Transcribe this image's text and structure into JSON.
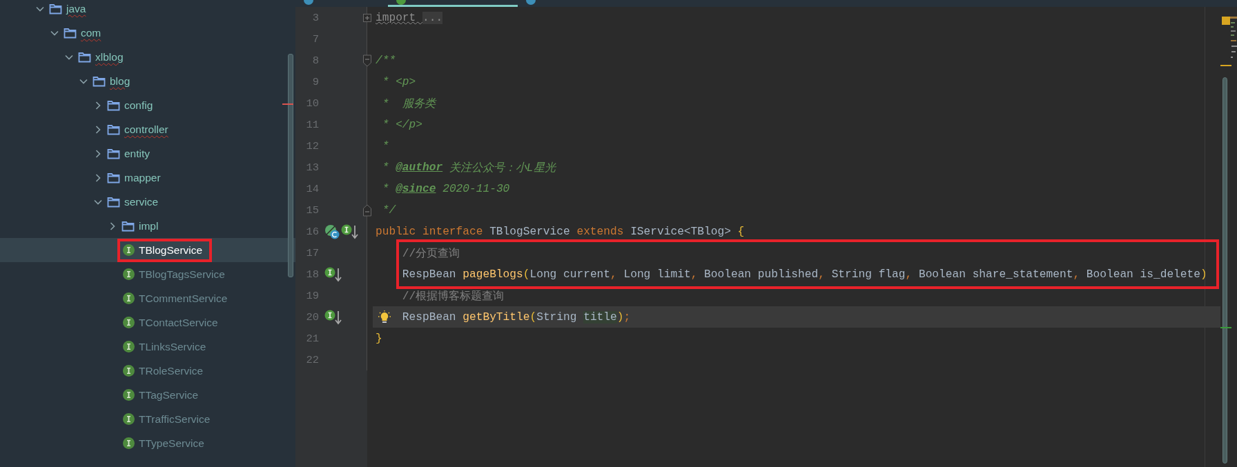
{
  "tabs": [
    {
      "color": "#3d8fb8",
      "selected": false
    },
    {
      "color": "#4e9a3e",
      "selected": true
    },
    {
      "color": "#3d8fb8",
      "selected": false
    }
  ],
  "project_tree": [
    {
      "label": "java",
      "kind": "folder",
      "expanded": true,
      "misspelled": true,
      "selected": false,
      "boxed": false,
      "children": [
        {
          "label": "com",
          "kind": "folder",
          "expanded": true,
          "misspelled": true,
          "selected": false,
          "boxed": false,
          "children": [
            {
              "label": "xlblog",
              "kind": "folder",
              "expanded": true,
              "misspelled": true,
              "selected": false,
              "boxed": false,
              "children": [
                {
                  "label": "blog",
                  "kind": "folder",
                  "expanded": true,
                  "misspelled": true,
                  "selected": false,
                  "boxed": false,
                  "children": [
                    {
                      "label": "config",
                      "kind": "folder",
                      "expanded": false,
                      "misspelled": false,
                      "selected": false,
                      "boxed": false
                    },
                    {
                      "label": "controller",
                      "kind": "folder",
                      "expanded": false,
                      "misspelled": true,
                      "selected": false,
                      "boxed": false
                    },
                    {
                      "label": "entity",
                      "kind": "folder",
                      "expanded": false,
                      "misspelled": false,
                      "selected": false,
                      "boxed": false
                    },
                    {
                      "label": "mapper",
                      "kind": "folder",
                      "expanded": false,
                      "misspelled": false,
                      "selected": false,
                      "boxed": false
                    },
                    {
                      "label": "service",
                      "kind": "folder",
                      "expanded": true,
                      "misspelled": false,
                      "selected": false,
                      "boxed": false,
                      "children": [
                        {
                          "label": "impl",
                          "kind": "folder",
                          "expanded": false,
                          "misspelled": false,
                          "selected": false,
                          "boxed": false
                        },
                        {
                          "label": "TBlogService",
                          "kind": "interface",
                          "misspelled": false,
                          "selected": true,
                          "boxed": true
                        },
                        {
                          "label": "TBlogTagsService",
                          "kind": "interface",
                          "misspelled": false,
                          "selected": false,
                          "boxed": false
                        },
                        {
                          "label": "TCommentService",
                          "kind": "interface",
                          "misspelled": false,
                          "selected": false,
                          "boxed": false
                        },
                        {
                          "label": "TContactService",
                          "kind": "interface",
                          "misspelled": false,
                          "selected": false,
                          "boxed": false
                        },
                        {
                          "label": "TLinksService",
                          "kind": "interface",
                          "misspelled": false,
                          "selected": false,
                          "boxed": false
                        },
                        {
                          "label": "TRoleService",
                          "kind": "interface",
                          "misspelled": false,
                          "selected": false,
                          "boxed": false
                        },
                        {
                          "label": "TTagService",
                          "kind": "interface",
                          "misspelled": false,
                          "selected": false,
                          "boxed": false
                        },
                        {
                          "label": "TTrafficService",
                          "kind": "interface",
                          "misspelled": false,
                          "selected": false,
                          "boxed": false
                        },
                        {
                          "label": "TTypeService",
                          "kind": "interface",
                          "misspelled": false,
                          "selected": false,
                          "boxed": false
                        }
                      ]
                    }
                  ]
                }
              ]
            }
          ]
        }
      ]
    }
  ],
  "editor": {
    "lines": [
      {
        "number": "3",
        "fold": {
          "kind": "collapsed"
        },
        "current": false,
        "boxed": false,
        "tokens": [
          {
            "kind": "unused",
            "text": "import "
          },
          {
            "kind": "folded",
            "text": "..."
          }
        ]
      },
      {
        "number": "7",
        "current": false,
        "boxed": false
      },
      {
        "number": "8",
        "fold": {
          "kind": "start"
        },
        "current": false,
        "boxed": false,
        "tokens": [
          {
            "kind": "doc",
            "text": "/**"
          }
        ]
      },
      {
        "number": "9",
        "current": false,
        "boxed": false,
        "tokens": [
          {
            "kind": "doc",
            "text": " * <p>"
          }
        ]
      },
      {
        "number": "10",
        "current": false,
        "boxed": false,
        "tokens": [
          {
            "kind": "doc",
            "text": " *  服务类"
          }
        ]
      },
      {
        "number": "11",
        "current": false,
        "boxed": false,
        "tokens": [
          {
            "kind": "doc",
            "text": " * </p>"
          }
        ]
      },
      {
        "number": "12",
        "current": false,
        "boxed": false,
        "tokens": [
          {
            "kind": "doc",
            "text": " *"
          }
        ]
      },
      {
        "number": "13",
        "current": false,
        "boxed": false,
        "tokens": [
          {
            "kind": "doc",
            "text": " * "
          },
          {
            "kind": "doctag",
            "text": "@author"
          },
          {
            "kind": "doc",
            "text": " 关注公众号：小L星光"
          }
        ]
      },
      {
        "number": "14",
        "current": false,
        "boxed": false,
        "tokens": [
          {
            "kind": "doc",
            "text": " * "
          },
          {
            "kind": "doctag",
            "text": "@since"
          },
          {
            "kind": "doc",
            "text": " 2020-11-30"
          }
        ]
      },
      {
        "number": "15",
        "fold": {
          "kind": "end"
        },
        "current": false,
        "boxed": false,
        "tokens": [
          {
            "kind": "doc",
            "text": " */"
          }
        ]
      },
      {
        "number": "16",
        "current": false,
        "boxed": false,
        "markers": [
          {
            "kind": "hierarchy"
          },
          {
            "kind": "implemented"
          }
        ],
        "tokens": [
          {
            "kind": "keyword",
            "text": "public interface "
          },
          {
            "kind": "plain",
            "text": "TBlogService "
          },
          {
            "kind": "keyword",
            "text": "extends "
          },
          {
            "kind": "plain",
            "text": "IService<TBlog> "
          },
          {
            "kind": "bracket",
            "text": "{"
          }
        ]
      },
      {
        "number": "17",
        "current": false,
        "boxed": true,
        "tokens": [
          {
            "kind": "comment",
            "text": "    //分页查询"
          }
        ]
      },
      {
        "number": "18",
        "current": false,
        "boxed": true,
        "markers": [
          {
            "kind": "implemented"
          }
        ],
        "tokens": [
          {
            "kind": "plain",
            "text": "    RespBean "
          },
          {
            "kind": "method",
            "text": "pageBlogs"
          },
          {
            "kind": "bracket",
            "text": "("
          },
          {
            "kind": "plain",
            "text": "Long current"
          },
          {
            "kind": "punct",
            "text": ", "
          },
          {
            "kind": "plain",
            "text": "Long limit"
          },
          {
            "kind": "punct",
            "text": ", "
          },
          {
            "kind": "plain",
            "text": "Boolean published"
          },
          {
            "kind": "punct",
            "text": ", "
          },
          {
            "kind": "plain",
            "text": "String flag"
          },
          {
            "kind": "punct",
            "text": ", "
          },
          {
            "kind": "plain",
            "text": "Boolean share_statement"
          },
          {
            "kind": "punct",
            "text": ", "
          },
          {
            "kind": "plain",
            "text": "Boolean is_delete"
          },
          {
            "kind": "bracket",
            "text": ")"
          }
        ]
      },
      {
        "number": "19",
        "current": false,
        "boxed": false,
        "tokens": [
          {
            "kind": "comment",
            "text": "    //根据博客标题查询"
          }
        ]
      },
      {
        "number": "20",
        "current": true,
        "boxed": false,
        "markers": [
          {
            "kind": "implemented"
          },
          {
            "kind": "bulb"
          }
        ],
        "tokens": [
          {
            "kind": "plain",
            "text": "    RespBean "
          },
          {
            "kind": "method",
            "text": "getByTitle"
          },
          {
            "kind": "bracket",
            "text": "("
          },
          {
            "kind": "plain",
            "text": "String "
          },
          {
            "kind": "usage",
            "text": "title"
          },
          {
            "kind": "bracket",
            "text": ")"
          },
          {
            "kind": "punct",
            "text": ";"
          }
        ]
      },
      {
        "number": "21",
        "current": false,
        "boxed": false,
        "tokens": [
          {
            "kind": "bracket",
            "text": "}"
          }
        ]
      },
      {
        "number": "22",
        "current": false,
        "boxed": false
      }
    ]
  }
}
